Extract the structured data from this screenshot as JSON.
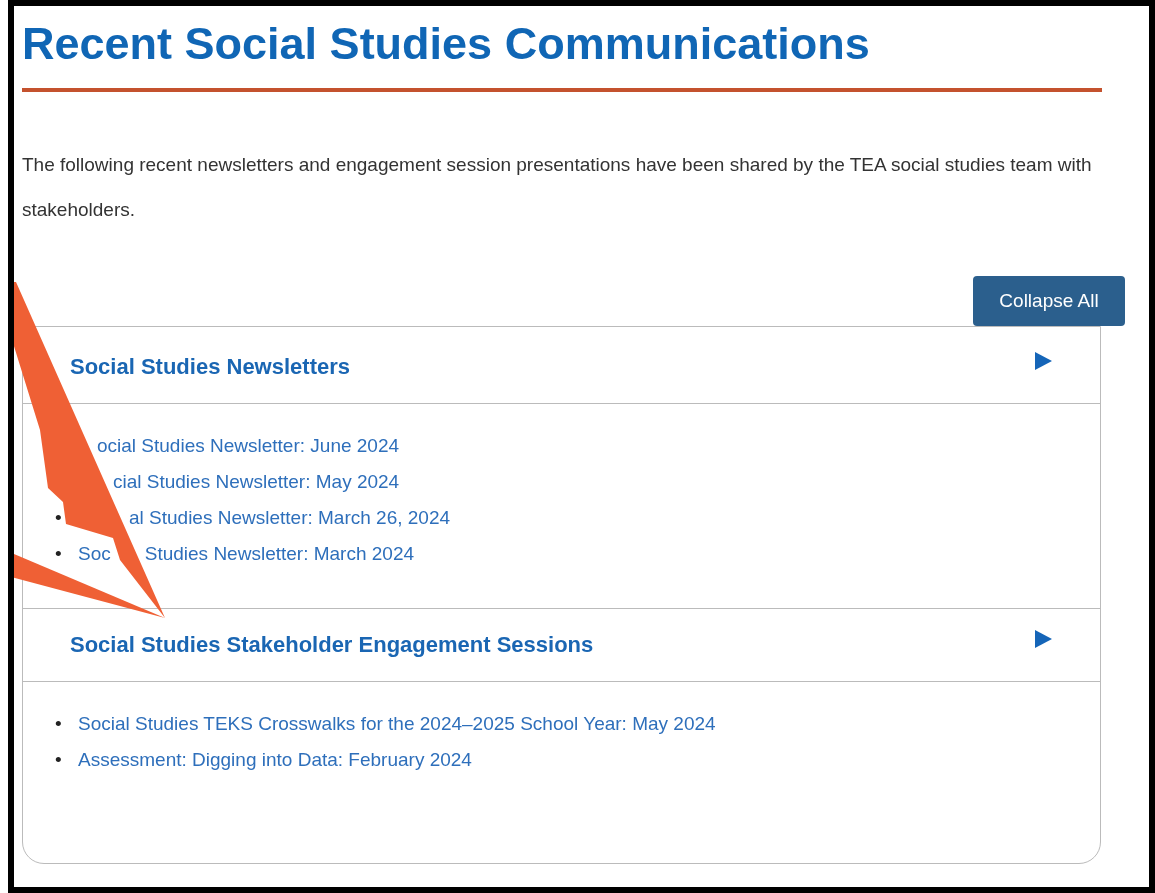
{
  "title": "Recent Social Studies Communications",
  "intro": "The following recent newsletters and engagement session presentations have been shared by the TEA social studies team with stakeholders.",
  "collapse_button": "Collapse All",
  "sections": [
    {
      "heading": "Social Studies Newsletters",
      "links": [
        {
          "segments": [
            "ocial Studies Newsletter: June 2024"
          ]
        },
        {
          "segments": [
            "cial Studies Newsletter: May 2024"
          ]
        },
        {
          "bullet": "•",
          "segments": [
            "al Studies Newsletter: March 26, 2024"
          ]
        },
        {
          "bullet": "•",
          "segments": [
            "Soc",
            "Studies Newsletter: March 2024"
          ]
        }
      ]
    },
    {
      "heading": "Social Studies Stakeholder Engagement Sessions",
      "links": [
        {
          "bullet": "•",
          "segments": [
            "Social Studies TEKS Crosswalks for the 2024–2025 School Year: May 2024"
          ]
        },
        {
          "bullet": "•",
          "segments": [
            "Assessment: Digging into Data: February 2024"
          ]
        }
      ]
    }
  ]
}
